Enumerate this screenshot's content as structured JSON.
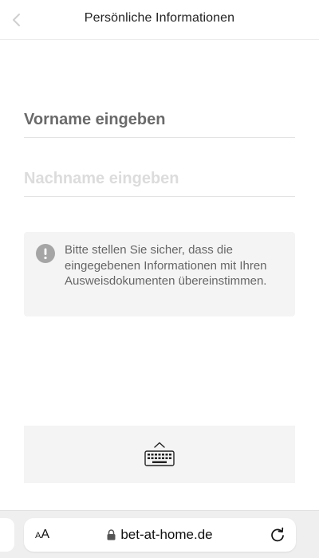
{
  "header": {
    "title": "Persönliche Informationen",
    "back_icon": "chevron-left-icon"
  },
  "form": {
    "first_name_placeholder": "Vorname eingeben",
    "last_name_placeholder": "Nachname eingeben"
  },
  "notice": {
    "icon": "exclamation-circle-icon",
    "text": "Bitte stellen Sie sicher, dass die eingegebenen Informationen mit Ihren Ausweisdokumenten übereinstimmen."
  },
  "keyboard_toggle": {
    "icon": "keyboard-icon"
  },
  "browser": {
    "text_size_label_small": "A",
    "text_size_label_large": "A",
    "url": "bet-at-home.de",
    "lock_icon": "lock-icon",
    "reload_icon": "reload-icon"
  },
  "colors": {
    "accent_gray": "#a5a5a5",
    "notice_bg": "#f4f4f4"
  }
}
